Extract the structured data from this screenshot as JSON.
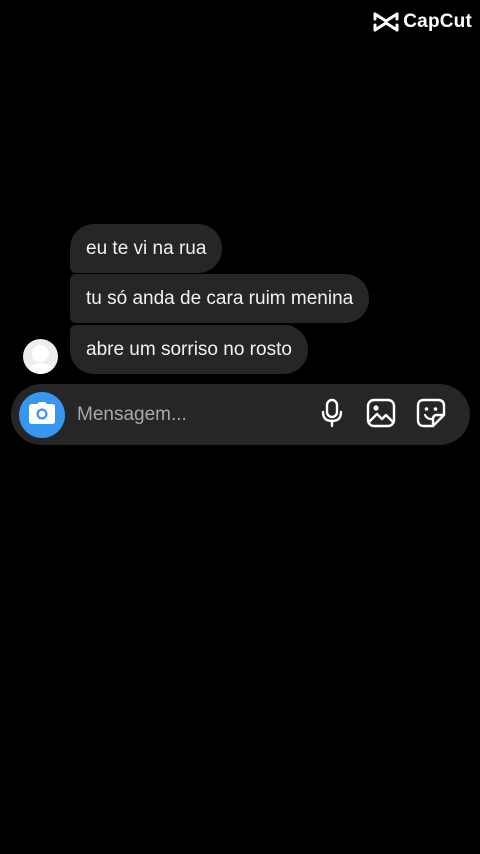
{
  "watermark": {
    "text": "CapCut",
    "icon": "capcut-logo-icon"
  },
  "conversation": {
    "messages": [
      {
        "text": "eu te vi na rua",
        "direction": "received"
      },
      {
        "text": "tu só anda de cara ruim menina",
        "direction": "received"
      },
      {
        "text": "abre um sorriso no rosto",
        "direction": "received"
      }
    ],
    "sender_avatar_icon": "default-avatar-icon"
  },
  "composer": {
    "placeholder": "Mensagem...",
    "value": "",
    "camera_icon": "camera-icon",
    "mic_icon": "microphone-icon",
    "gallery_icon": "gallery-icon",
    "sticker_icon": "sticker-icon"
  },
  "colors": {
    "background": "#000000",
    "bubble": "#262626",
    "accent": "#3797f0",
    "text": "#f2f2f2",
    "placeholder": "#a8a8a8"
  }
}
